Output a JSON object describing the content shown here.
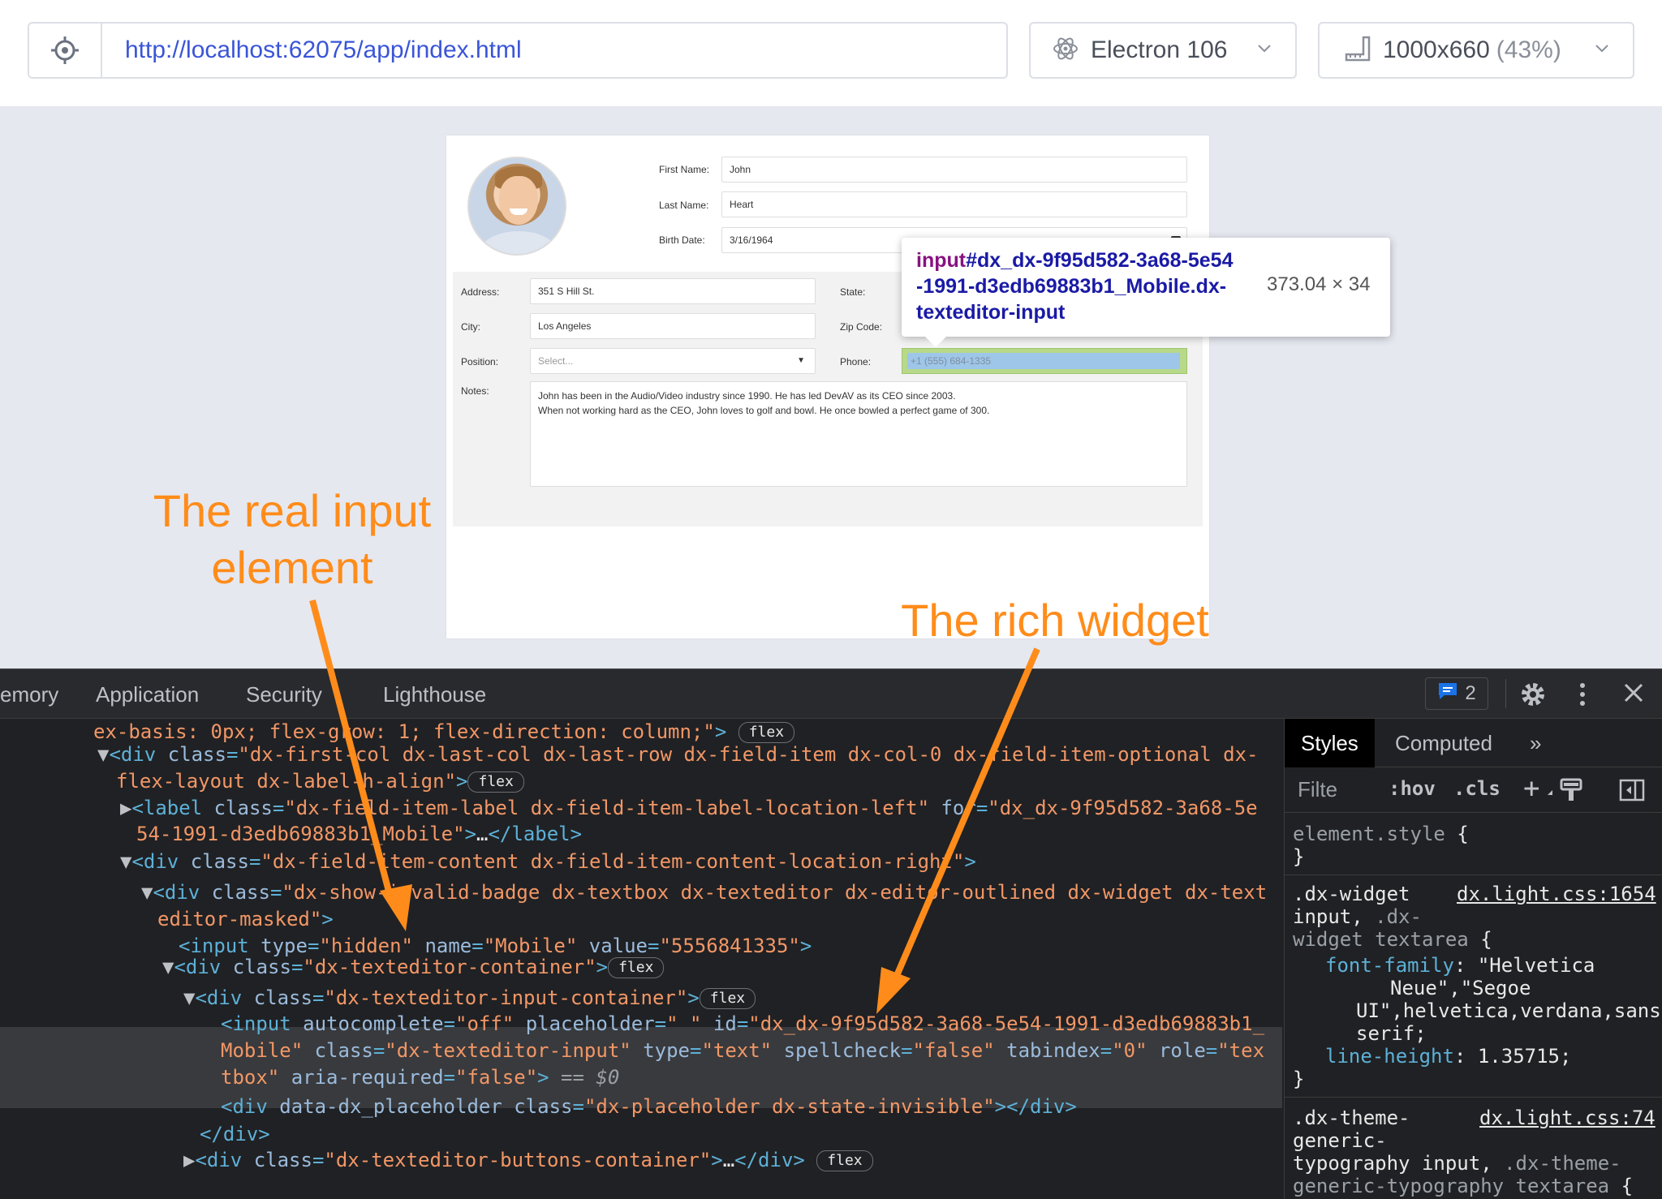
{
  "toolbar": {
    "url": "http://localhost:62075/app/index.html",
    "browser": "Electron 106",
    "viewport_size": "1000x660",
    "zoom": "(43%)"
  },
  "form": {
    "first_name_label": "First Name:",
    "first_name": "John",
    "last_name_label": "Last Name:",
    "last_name": "Heart",
    "birth_date_label": "Birth Date:",
    "birth_date": "3/16/1964",
    "address_label": "Address:",
    "address": "351 S Hill St.",
    "state_label": "State:",
    "city_label": "City:",
    "city": "Los Angeles",
    "zip_label": "Zip Code:",
    "position_label": "Position:",
    "position_placeholder": "Select...",
    "phone_label": "Phone:",
    "phone": "+1 (555) 684-1335",
    "notes_label": "Notes:",
    "notes_line1": "John has been in the Audio/Video industry since 1990. He has led DevAV as its CEO since 2003.",
    "notes_line2": "When not working hard as the CEO, John loves to golf and bowl. He once bowled a perfect game of 300."
  },
  "tooltip": {
    "tag": "input",
    "id_part1": "#dx_dx-9f95d582-3a68-5e54",
    "id_part2": "-1991-d3edb69883b1_Mobile.dx-",
    "id_part3": "texteditor-input",
    "dimensions": "373.04 × 34"
  },
  "annotations": {
    "left_line1": "The real input",
    "left_line2": "element",
    "right": "The rich widget"
  },
  "devtools": {
    "tabs": [
      "emory",
      "Application",
      "Security",
      "Lighthouse"
    ],
    "issues_count": "2",
    "styles_tabs": {
      "styles": "Styles",
      "computed": "Computed",
      "more": "»"
    },
    "filter_placeholder": "Filte",
    "hov": ":hov",
    "cls": ".cls",
    "colors": {
      "accent": "#ff8c1a",
      "tag": "#5db0d7",
      "attr_value": "#f29766"
    }
  }
}
